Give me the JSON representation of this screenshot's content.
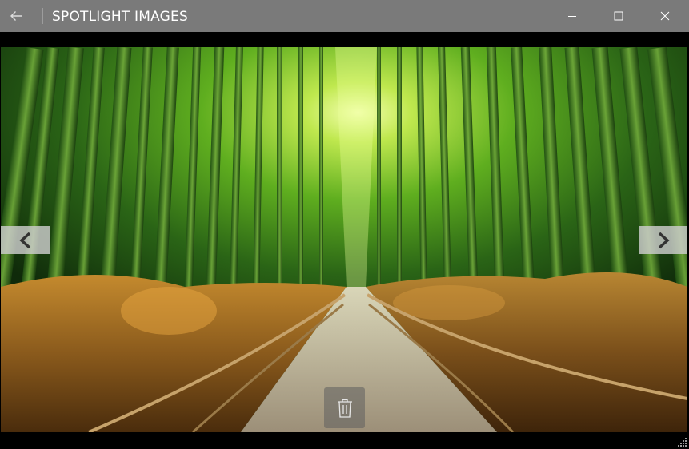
{
  "window": {
    "title": "SPOTLIGHT IMAGES"
  },
  "titlebar": {
    "back_icon": "back-arrow-icon",
    "minimize_icon": "minimize-icon",
    "maximize_icon": "maximize-icon",
    "close_icon": "close-icon"
  },
  "viewer": {
    "image_subject": "bamboo-forest-path",
    "prev_icon": "chevron-left-icon",
    "next_icon": "chevron-right-icon",
    "delete_icon": "trash-icon"
  },
  "colors": {
    "titlebar_bg": "#7a7a7a",
    "letterbox": "#000000",
    "nav_button_bg": "#cdcdcd",
    "delete_button_bg": "#5f5f5f"
  }
}
